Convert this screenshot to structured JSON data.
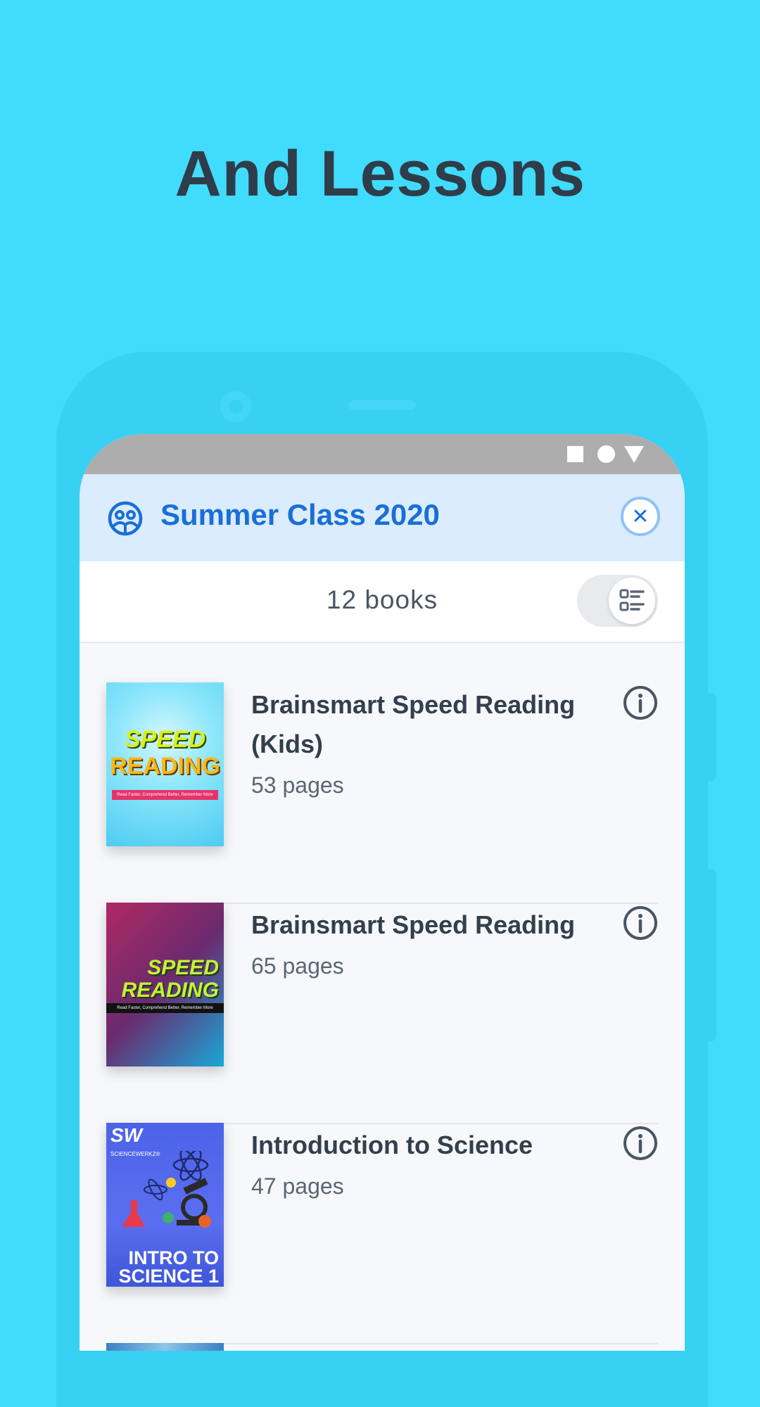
{
  "headline": "And Lessons",
  "class": {
    "title": "Summer Class 2020",
    "icon": "class-group-icon",
    "close_icon": "close-icon",
    "close_glyph": "✕"
  },
  "book_count": "12 books",
  "view_toggle_icon": "list-view-icon",
  "books": [
    {
      "title": "Brainsmart Speed Reading (Kids)",
      "pages": "53 pages",
      "cover_text": [
        "SPEED",
        "READING"
      ],
      "cover_sub": "Read Faster, Comprehend Better, Remember More"
    },
    {
      "title": "Brainsmart Speed Reading",
      "pages": "65 pages",
      "cover_text": [
        "SPEED",
        "READING"
      ],
      "cover_sub": "Read Faster, Comprehend Better, Remember More"
    },
    {
      "title": "Introduction to Science",
      "pages": "47 pages",
      "cover_text": [
        "SW",
        "SCIENCEWERKZ®",
        "INTRO TO",
        "SCIENCE 1"
      ]
    }
  ],
  "colors": {
    "background": "#41dcfd",
    "accent": "#1a6fd6",
    "header_bg": "#daecfd"
  }
}
